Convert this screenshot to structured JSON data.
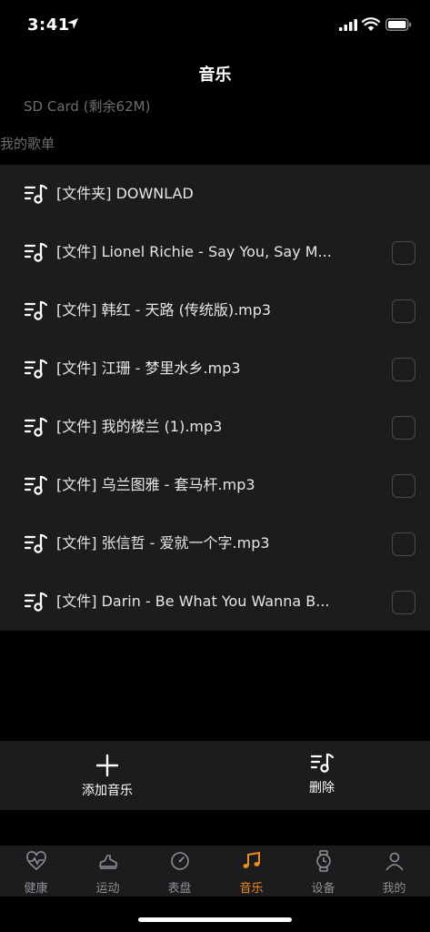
{
  "status": {
    "time": "3:41"
  },
  "nav": {
    "title": "音乐"
  },
  "storage": {
    "info": "SD Card (剩余62M)"
  },
  "section": {
    "label": "我的歌单"
  },
  "list": [
    {
      "text": "[文件夹] DOWNLAD",
      "checkbox": false
    },
    {
      "text": "[文件] Lionel Richie - Say You, Say M...",
      "checkbox": true
    },
    {
      "text": "[文件] 韩红 - 天路 (传统版).mp3",
      "checkbox": true
    },
    {
      "text": "[文件] 江珊 - 梦里水乡.mp3",
      "checkbox": true
    },
    {
      "text": "[文件] 我的楼兰 (1).mp3",
      "checkbox": true
    },
    {
      "text": "[文件] 乌兰图雅 - 套马杆.mp3",
      "checkbox": true
    },
    {
      "text": "[文件] 张信哲 - 爱就一个字.mp3",
      "checkbox": true
    },
    {
      "text": "[文件] Darin - Be What You Wanna B...",
      "checkbox": true
    }
  ],
  "actions": {
    "add_label": "添加音乐",
    "delete_label": "删除"
  },
  "tabs": [
    {
      "label": "健康",
      "icon": "heart-pulse-icon"
    },
    {
      "label": "运动",
      "icon": "shoe-icon"
    },
    {
      "label": "表盘",
      "icon": "gauge-icon"
    },
    {
      "label": "音乐",
      "icon": "music-note-icon",
      "active": true
    },
    {
      "label": "设备",
      "icon": "watch-icon"
    },
    {
      "label": "我的",
      "icon": "person-icon"
    }
  ],
  "colors": {
    "accent": "#f08c1e",
    "background": "#000000",
    "surface": "#1c1c1e",
    "muted": "#6e6e6e"
  }
}
